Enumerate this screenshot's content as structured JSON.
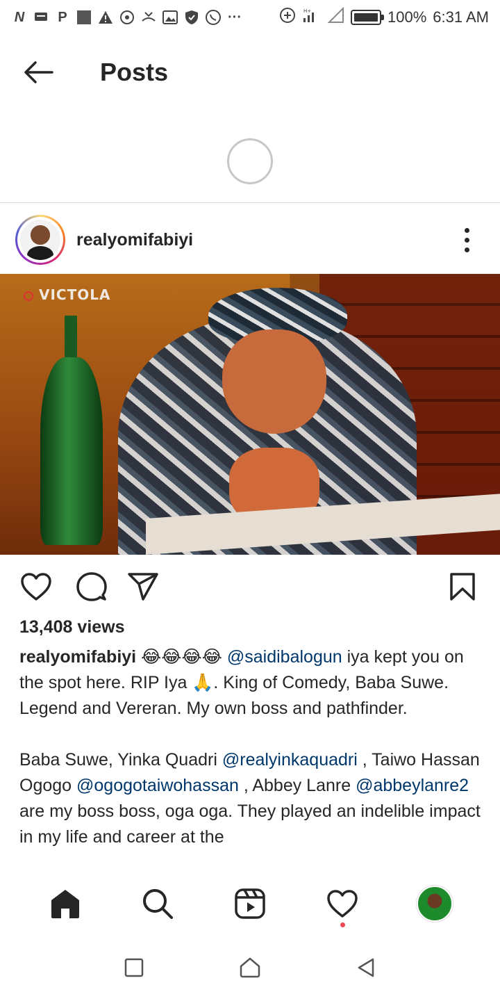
{
  "status_bar": {
    "left_icons": [
      "n-icon",
      "message-icon",
      "p-icon",
      "image-box-icon",
      "warning-icon",
      "vpn-icon",
      "missed-call-icon",
      "gallery-icon",
      "shield-icon",
      "whatsapp-icon",
      "more-dots-icon"
    ],
    "battery_percent": "100%",
    "time": "6:31 AM",
    "battery_level": 1.0
  },
  "header": {
    "title": "Posts"
  },
  "post": {
    "username": "realyomifabiyi",
    "media": {
      "watermark": "VICTOLA"
    },
    "views": "13,408 views",
    "caption": {
      "user": "realyomifabiyi",
      "emoji_run": " 😂😂😂😂 ",
      "mention1": "@saidibalogun",
      "text1": " iya kept you on the spot here. RIP Iya 🙏. King of Comedy, Baba Suwe. Legend and Vereran. My own boss and pathfinder.",
      "p2_text1": "Baba Suwe, Yinka Quadri ",
      "mention2": "@realyinkaquadri",
      "p2_text2": " , Taiwo Hassan Ogogo ",
      "mention3": "@ogogotaiwohassan",
      "p2_text3": " , Abbey Lanre ",
      "mention4": "@abbeylanre2",
      "p2_text4": " are my boss boss, oga oga. They played an indelible impact in my life and career at the"
    }
  },
  "bottom_nav": {
    "items": [
      "home-icon",
      "search-icon",
      "reels-icon",
      "activity-heart-icon",
      "profile-avatar"
    ],
    "has_notification_dot": true
  },
  "system_nav": {
    "items": [
      "recents-square-icon",
      "home-house-icon",
      "back-triangle-icon"
    ]
  },
  "colors": {
    "text": "#262626",
    "mention": "#00376b",
    "divider": "#dbdbdb",
    "notification": "#ed4956"
  }
}
